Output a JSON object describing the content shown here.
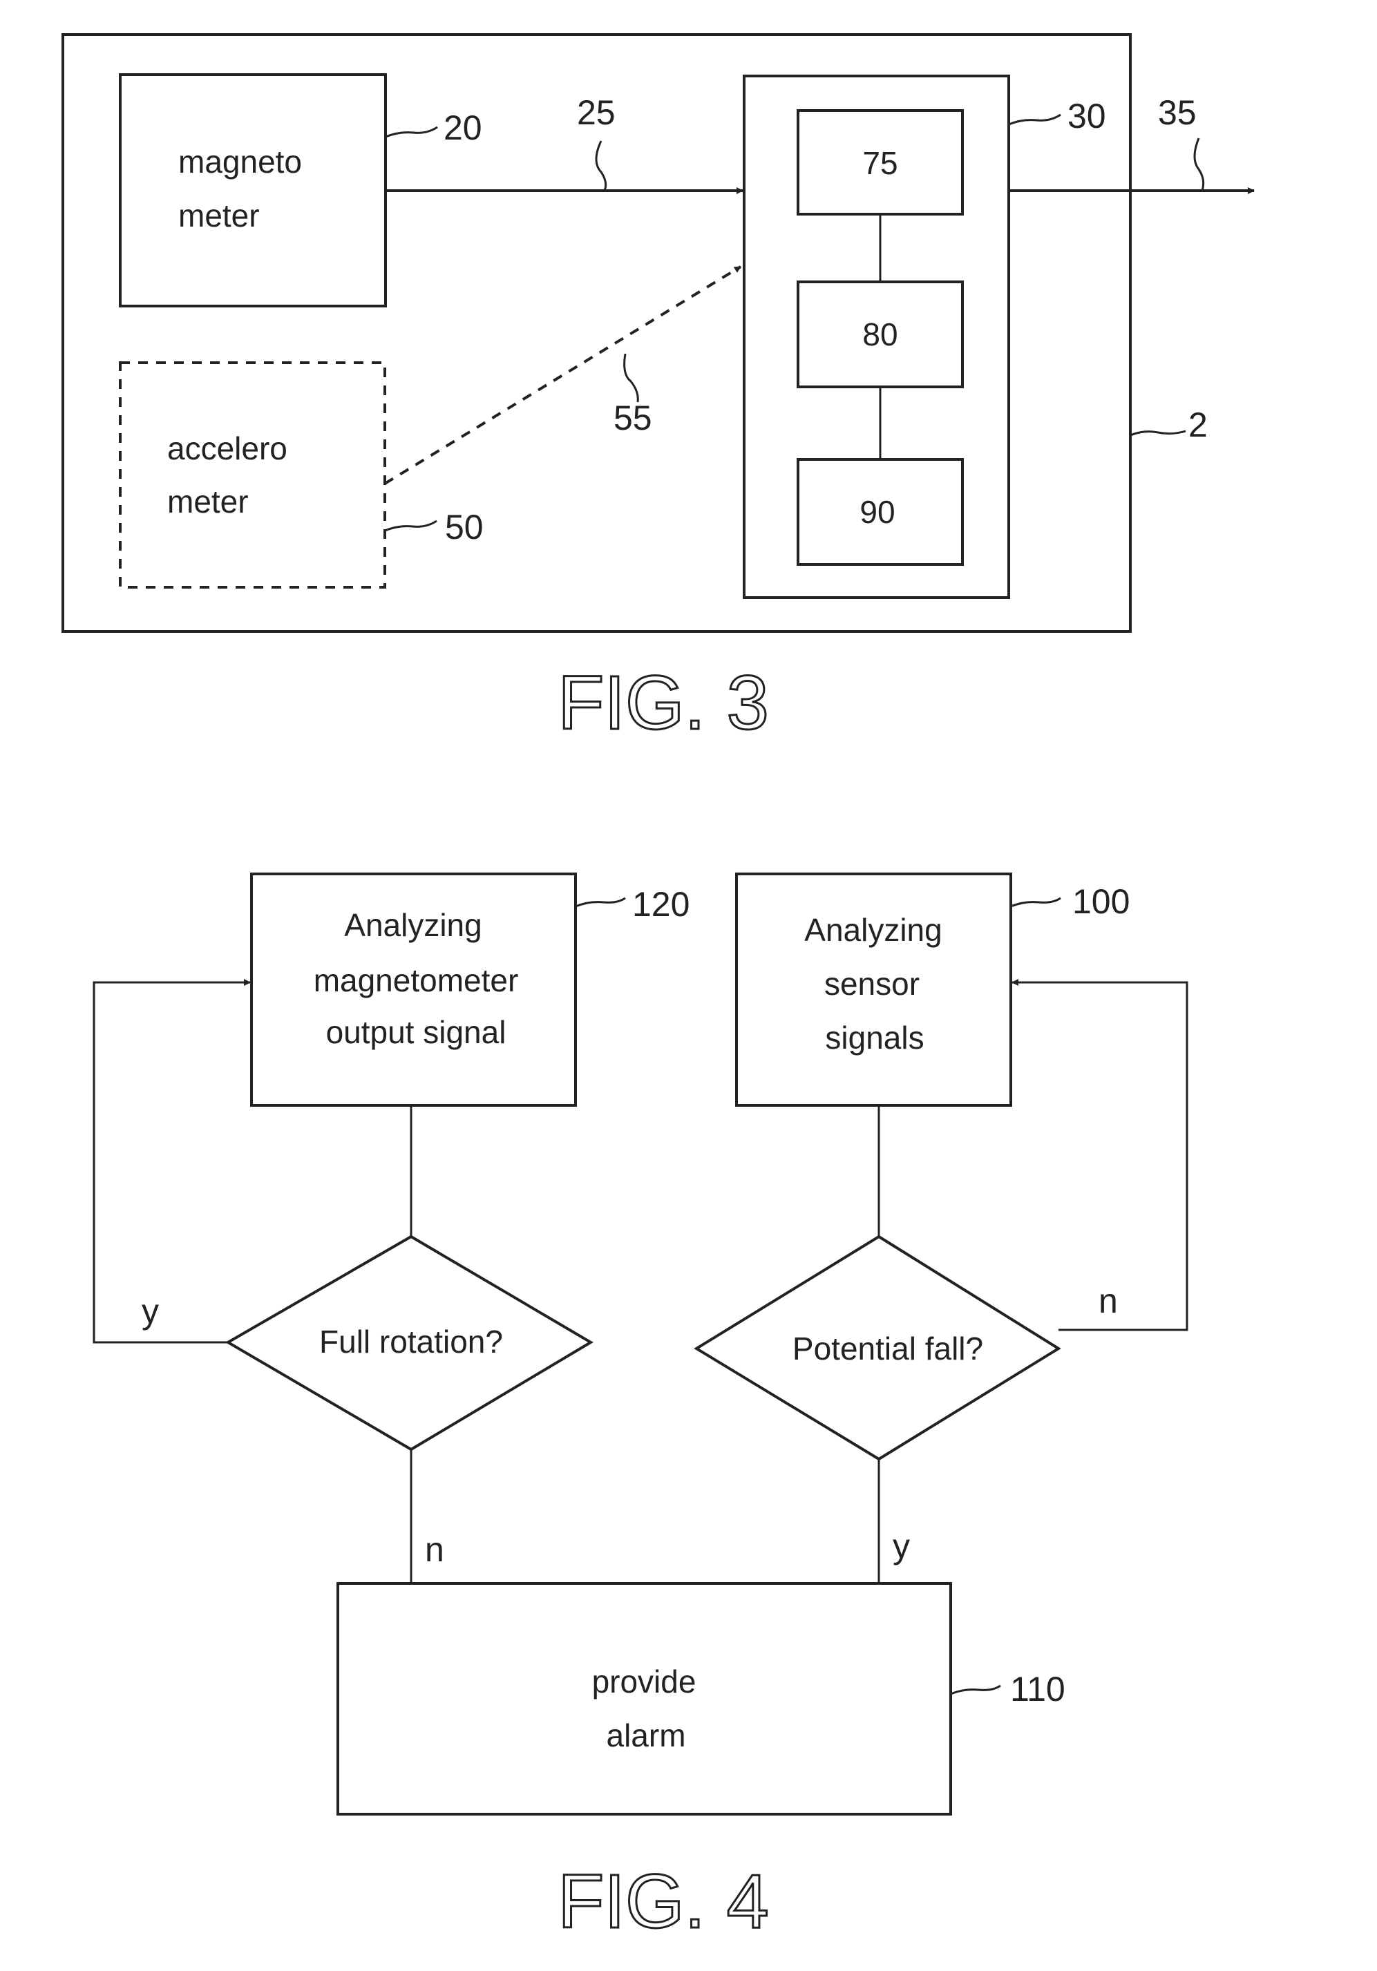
{
  "fig3": {
    "caption": "FIG. 3",
    "device_ref": "2",
    "magnetometer": {
      "line1": "magneto",
      "line2": "meter",
      "ref": "20"
    },
    "accelerometer": {
      "line1": "accelero",
      "line2": "meter",
      "ref": "50"
    },
    "processor": {
      "ref": "30",
      "sub_blocks": [
        "75",
        "80",
        "90"
      ]
    },
    "signal_refs": {
      "magnetometer_signal": "25",
      "accelerometer_signal": "55",
      "output": "35"
    }
  },
  "fig4": {
    "caption": "FIG. 4",
    "analyze_magnetometer": {
      "line1": "Analyzing",
      "line2": "magnetometer",
      "line3": "output signal",
      "ref": "120"
    },
    "analyze_sensor": {
      "line1": "Analyzing",
      "line2": "sensor",
      "line3": "signals",
      "ref": "100"
    },
    "decision_rotation": {
      "text": "Full rotation?",
      "yes": "y",
      "no": "n"
    },
    "decision_fall": {
      "text": "Potential fall?",
      "yes": "y",
      "no": "n"
    },
    "alarm": {
      "line1": "provide",
      "line2": "alarm",
      "ref": "110"
    }
  }
}
